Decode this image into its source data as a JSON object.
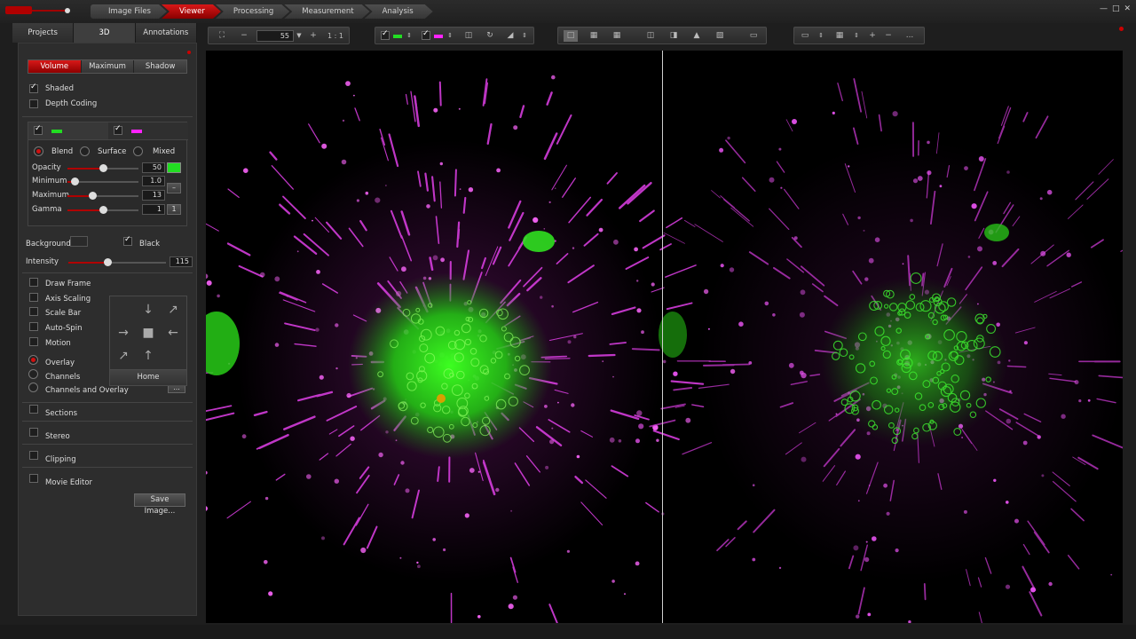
{
  "workflow": {
    "steps": [
      "Image Files",
      "Viewer",
      "Processing",
      "Measurement",
      "Analysis"
    ],
    "active": "Viewer"
  },
  "window_controls": [
    "—",
    "□",
    "✕"
  ],
  "left_panel": {
    "tabs": [
      "Projects",
      "3D",
      "Annotations"
    ],
    "render_modes": [
      "Volume",
      "Maximum",
      "Shadow"
    ],
    "shaded_label": "Shaded",
    "depth_coding_label": "Depth Coding",
    "channel_colors": [
      "#22dd22",
      "#ff22ff"
    ],
    "blend_modes": [
      "Blend",
      "Surface",
      "Mixed"
    ],
    "opacity": {
      "label": "Opacity",
      "value": "50",
      "level": 0.5
    },
    "minimum": {
      "label": "Minimum",
      "value": "1.0",
      "level": 0.1
    },
    "maximum": {
      "label": "Maximum",
      "value": "13",
      "level": 0.35
    },
    "gamma": {
      "label": "Gamma",
      "value": "1",
      "btn": "1",
      "level": 0.5
    },
    "background_label": "Background",
    "black_label": "Black",
    "intensity": {
      "label": "Intensity",
      "value": "115",
      "level": 0.4
    },
    "options": [
      "Draw Frame",
      "Axis Scaling",
      "Scale Bar",
      "Auto-Spin",
      "Motion"
    ],
    "display_modes": [
      "Overlay",
      "Channels",
      "Channels and Overlay"
    ],
    "home_label": "Home",
    "sections_label": "Sections",
    "stereo_label": "Stereo",
    "clipping_label": "Clipping",
    "movie_editor_label": "Movie Editor",
    "save_image_label": "Save Image...",
    "more_label": "..."
  },
  "toolbar": {
    "zoom_value": "55",
    "one_to_one": "1 : 1",
    "dots": "..."
  },
  "colors": {
    "accent": "#c00000",
    "green": "#22dd22",
    "magenta": "#ff22ff"
  }
}
